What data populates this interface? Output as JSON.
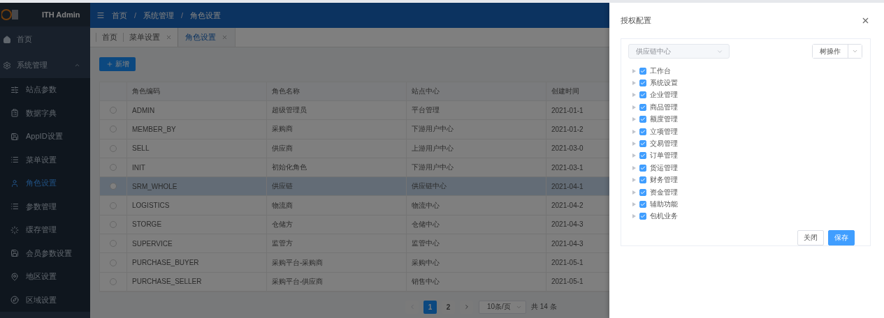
{
  "sidebar": {
    "logo_text": "ITH Admin",
    "items": [
      {
        "label": "首页"
      },
      {
        "label": "系统管理",
        "expanded": true,
        "children": [
          {
            "label": "站点参数",
            "selected": false
          },
          {
            "label": "数据字典",
            "selected": false
          },
          {
            "label": "AppID设置",
            "selected": false
          },
          {
            "label": "菜单设置",
            "selected": false
          },
          {
            "label": "角色设置",
            "selected": true
          },
          {
            "label": "参数管理",
            "selected": false
          },
          {
            "label": "缓存管理",
            "selected": false
          },
          {
            "label": "会员参数设置",
            "selected": false
          },
          {
            "label": "地区设置",
            "selected": false
          },
          {
            "label": "区域设置",
            "selected": false
          }
        ]
      }
    ]
  },
  "breadcrumb": [
    {
      "label": "首页"
    },
    {
      "separator": "/",
      "label": "系统管理"
    },
    {
      "separator": "/",
      "label": "角色设置"
    }
  ],
  "tabs": [
    {
      "label": "首页",
      "selected": false,
      "closable": false
    },
    {
      "label": "菜单设置",
      "selected": false,
      "closable": true
    },
    {
      "label": "角色设置",
      "selected": true,
      "closable": true
    }
  ],
  "add_button": "新增",
  "table": {
    "columns": [
      "角色编码",
      "角色名称",
      "站点中心",
      "创建时间"
    ],
    "rows": [
      {
        "selected": false,
        "highlighted": false,
        "cells": [
          "ADMIN",
          "超级管理员",
          "平台管理",
          "2021-01-1"
        ]
      },
      {
        "selected": false,
        "highlighted": false,
        "cells": [
          "MEMBER_BY",
          "采购商",
          "下游用户中心",
          "2021-01-2"
        ]
      },
      {
        "selected": false,
        "highlighted": false,
        "cells": [
          "SELL",
          "供应商",
          "上游用户中心",
          "2021-03-0"
        ]
      },
      {
        "selected": false,
        "highlighted": false,
        "cells": [
          "INIT",
          "初始化角色",
          "下游用户中心",
          "2021-03-1"
        ]
      },
      {
        "selected": false,
        "highlighted": true,
        "cells": [
          "SRM_WHOLE",
          "供应链",
          "供应链中心",
          "2021-04-1"
        ]
      },
      {
        "selected": false,
        "highlighted": false,
        "cells": [
          "LOGISTICS",
          "物流商",
          "物流中心",
          "2021-04-2"
        ]
      },
      {
        "selected": false,
        "highlighted": false,
        "cells": [
          "STORGE",
          "仓储方",
          "仓储中心",
          "2021-04-3"
        ]
      },
      {
        "selected": false,
        "highlighted": false,
        "cells": [
          "SUPERVICE",
          "监管方",
          "监管中心",
          "2021-04-3"
        ]
      },
      {
        "selected": false,
        "highlighted": false,
        "cells": [
          "PURCHASE_BUYER",
          "采购平台-采购商",
          "采购中心",
          "2021-05-1"
        ]
      },
      {
        "selected": false,
        "highlighted": false,
        "cells": [
          "PURCHASE_SELLER",
          "采购平台-供应商",
          "销售中心",
          "2021-05-1"
        ]
      }
    ]
  },
  "pagination": {
    "prev_disabled": true,
    "next_disabled": false,
    "pages": [
      {
        "label": "1",
        "selected": true
      },
      {
        "label": "2",
        "selected": false
      }
    ],
    "page_size": "10条/页",
    "total": "共 14 条"
  },
  "drawer": {
    "title": "授权配置",
    "site_select": {
      "value": "供应链中心",
      "disabled": true
    },
    "tree_menu": "树操作",
    "tree": [
      {
        "label": "工作台",
        "checked": true,
        "expanded": false
      },
      {
        "label": "系统设置",
        "checked": true,
        "expanded": false
      },
      {
        "label": "企业管理",
        "checked": true,
        "expanded": false
      },
      {
        "label": "商品管理",
        "checked": true,
        "expanded": false
      },
      {
        "label": "额度管理",
        "checked": true,
        "expanded": false
      },
      {
        "label": "立项管理",
        "checked": true,
        "expanded": false
      },
      {
        "label": "交易管理",
        "checked": true,
        "expanded": false
      },
      {
        "label": "订单管理",
        "checked": true,
        "expanded": false
      },
      {
        "label": "货运管理",
        "checked": true,
        "expanded": false
      },
      {
        "label": "财务管理",
        "checked": true,
        "expanded": false
      },
      {
        "label": "资金管理",
        "checked": true,
        "expanded": false
      },
      {
        "label": "辅助功能",
        "checked": true,
        "expanded": false
      },
      {
        "label": "包机业务",
        "checked": true,
        "expanded": false
      }
    ],
    "buttons": [
      {
        "label": "关闭",
        "kind": "default"
      },
      {
        "label": "保存",
        "kind": "primary"
      }
    ]
  }
}
